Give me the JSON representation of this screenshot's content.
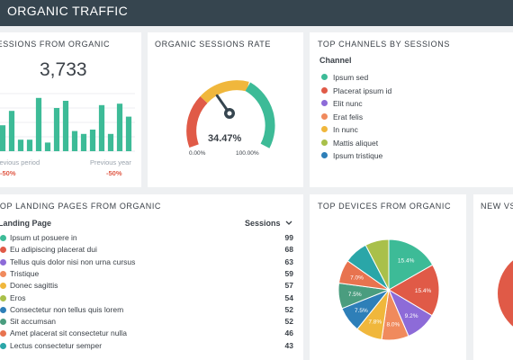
{
  "header": {
    "title": "ORGANIC TRAFFIC"
  },
  "sessions_card": {
    "title": "SESSIONS FROM ORGANIC",
    "value": "3,733",
    "prev_period_label": "Previous period",
    "prev_period_change": "-50%",
    "prev_year_label": "Previous year",
    "prev_year_change": "-50%",
    "bar_color": "#3dbb97"
  },
  "rate_card": {
    "title": "ORGANIC SESSIONS RATE",
    "value": "34.47%",
    "value_num": 34.47,
    "min_label": "0.00%",
    "max_label": "100.00%"
  },
  "channels_card": {
    "title": "TOP CHANNELS BY SESSIONS",
    "header": "Channel",
    "items": [
      {
        "label": "Ipsum sed",
        "color": "#3dbb97"
      },
      {
        "label": "Placerat ipsum id",
        "color": "#e05a47"
      },
      {
        "label": "Elit nunc",
        "color": "#8d6bd8"
      },
      {
        "label": "Erat felis",
        "color": "#f08a5d"
      },
      {
        "label": "In nunc",
        "color": "#f0b73c"
      },
      {
        "label": "Mattis aliquet",
        "color": "#a9c04a"
      },
      {
        "label": "Ipsum tristique",
        "color": "#2e7fb8"
      }
    ]
  },
  "landing_card": {
    "title": "TOP LANDING PAGES FROM ORGANIC",
    "col_page": "Landing Page",
    "col_sessions": "Sessions",
    "sort_icon": "chevron-down-icon",
    "rows": [
      {
        "label": "Ipsum ut posuere in",
        "value": "99",
        "color": "#3dbb97"
      },
      {
        "label": "Eu adipiscing placerat dui",
        "value": "68",
        "color": "#e05a47"
      },
      {
        "label": "Tellus quis dolor nisi non urna cursus",
        "value": "63",
        "color": "#8d6bd8"
      },
      {
        "label": "Tristique",
        "value": "59",
        "color": "#f08a5d"
      },
      {
        "label": "Donec sagittis",
        "value": "57",
        "color": "#f0b73c"
      },
      {
        "label": "Eros",
        "value": "54",
        "color": "#a9c04a"
      },
      {
        "label": "Consectetur non tellus quis lorem",
        "value": "52",
        "color": "#2e7fb8"
      },
      {
        "label": "Sit accumsan",
        "value": "52",
        "color": "#4a9d7f"
      },
      {
        "label": "Amet placerat sit consectetur nulla",
        "value": "46",
        "color": "#e8734f"
      },
      {
        "label": "Lectus consectetur semper",
        "value": "43",
        "color": "#2aa6a8"
      }
    ]
  },
  "devices_card": {
    "title": "TOP DEVICES FROM ORGANIC"
  },
  "new_card": {
    "title": "NEW VS"
  },
  "chart_data": [
    {
      "type": "bar",
      "title": "SESSIONS FROM ORGANIC",
      "values": [
        18,
        28,
        8,
        8,
        37,
        6,
        30,
        35,
        14,
        12,
        15,
        32,
        12,
        33,
        24
      ],
      "ylim": [
        0,
        40
      ],
      "grid": true
    },
    {
      "type": "pie",
      "title": "TOP DEVICES FROM ORGANIC",
      "values": [
        15.4,
        15.4,
        9.2,
        8.0,
        7.8,
        7.5,
        7.5,
        7.0,
        7.0,
        7.0
      ],
      "labels": [
        "15.4%",
        "15.4%",
        "9.2%",
        "8.0%",
        "7.8%",
        "7.5%",
        "7.5%",
        "7.0%",
        "",
        ""
      ],
      "colors": [
        "#3dbb97",
        "#e05a47",
        "#8d6bd8",
        "#f08a5d",
        "#f0b73c",
        "#2e7fb8",
        "#4a9d7f",
        "#e8734f",
        "#2aa6a8",
        "#a9c04a"
      ]
    }
  ]
}
